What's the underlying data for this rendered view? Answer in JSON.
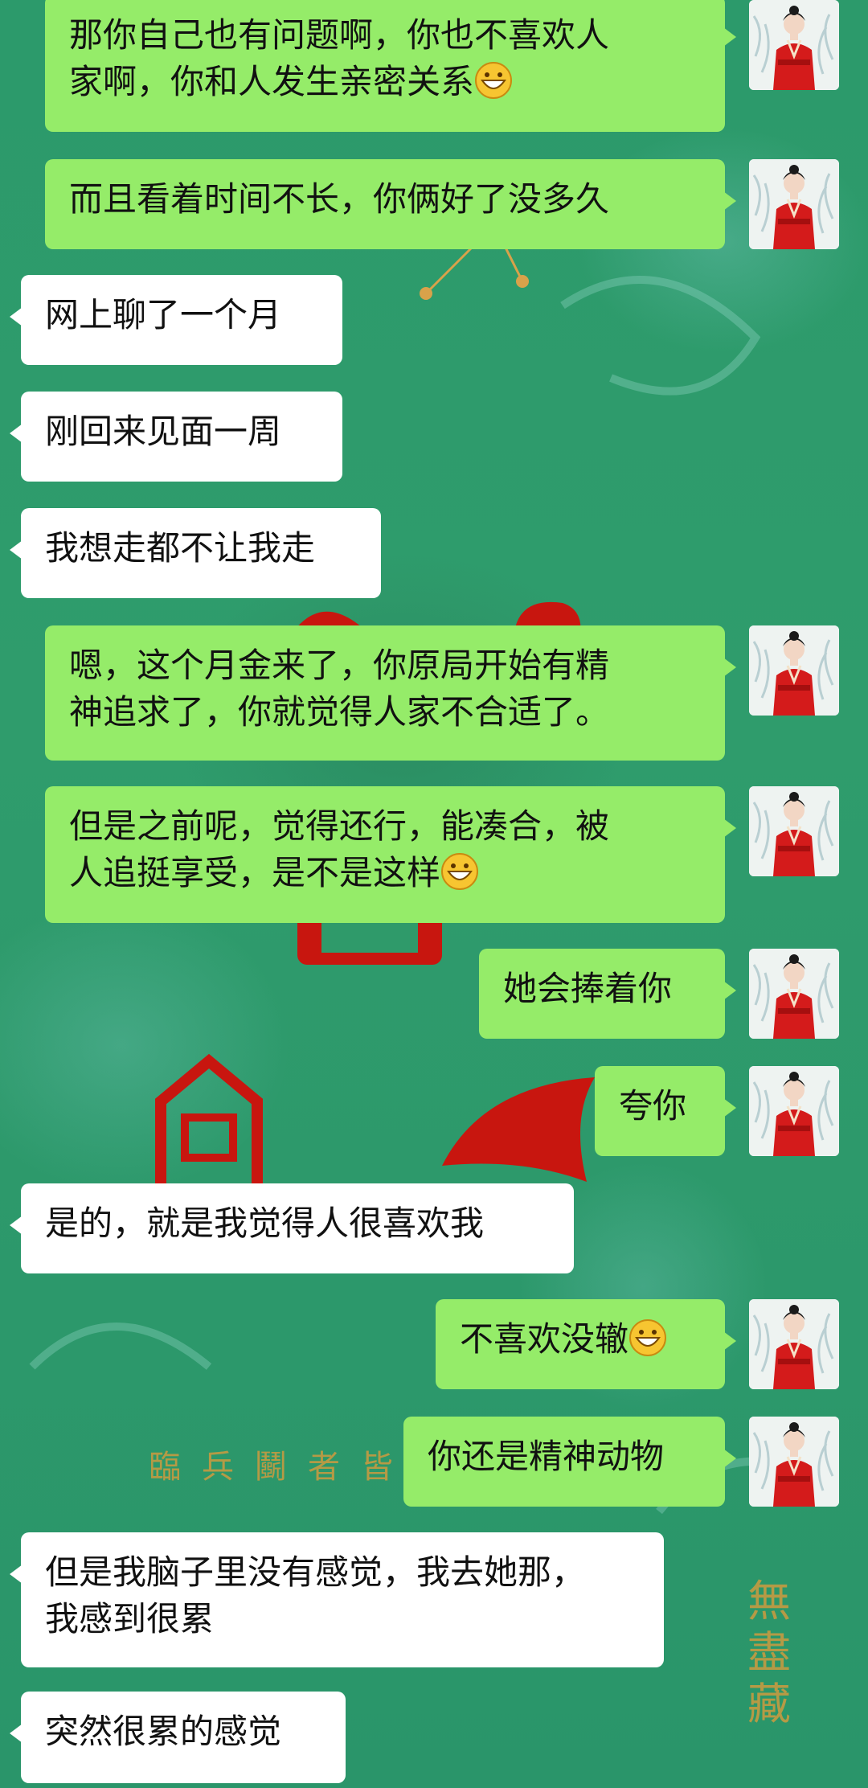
{
  "background": {
    "watermark_row": "臨兵鬬者皆",
    "watermark_col": "無盡藏"
  },
  "messages": [
    {
      "side": "out",
      "text": "那你自己也有问题啊，你也不喜欢人\n家啊，你和人发生亲密关系",
      "emoji": "grinning-face-icon"
    },
    {
      "side": "out",
      "text": "而且看着时间不长，你俩好了没多久"
    },
    {
      "side": "in",
      "text": "网上聊了一个月"
    },
    {
      "side": "in",
      "text": "刚回来见面一周"
    },
    {
      "side": "in",
      "text": "我想走都不让我走"
    },
    {
      "side": "out",
      "text": "嗯，这个月金来了，你原局开始有精\n神追求了，你就觉得人家不合适了。"
    },
    {
      "side": "out",
      "text": "但是之前呢，觉得还行，能凑合，被\n人追挺享受，是不是这样",
      "emoji": "grinning-face-icon"
    },
    {
      "side": "out",
      "text": "她会捧着你"
    },
    {
      "side": "out",
      "text": "夸你"
    },
    {
      "side": "in",
      "text": "是的，就是我觉得人很喜欢我"
    },
    {
      "side": "out",
      "text": "不喜欢没辙",
      "emoji": "grinning-face-icon"
    },
    {
      "side": "out",
      "text": "你还是精神动物"
    },
    {
      "side": "in",
      "text": "但是我脑子里没有感觉，我去她那，\n我感到很累"
    },
    {
      "side": "in",
      "text": "突然很累的感觉"
    }
  ]
}
